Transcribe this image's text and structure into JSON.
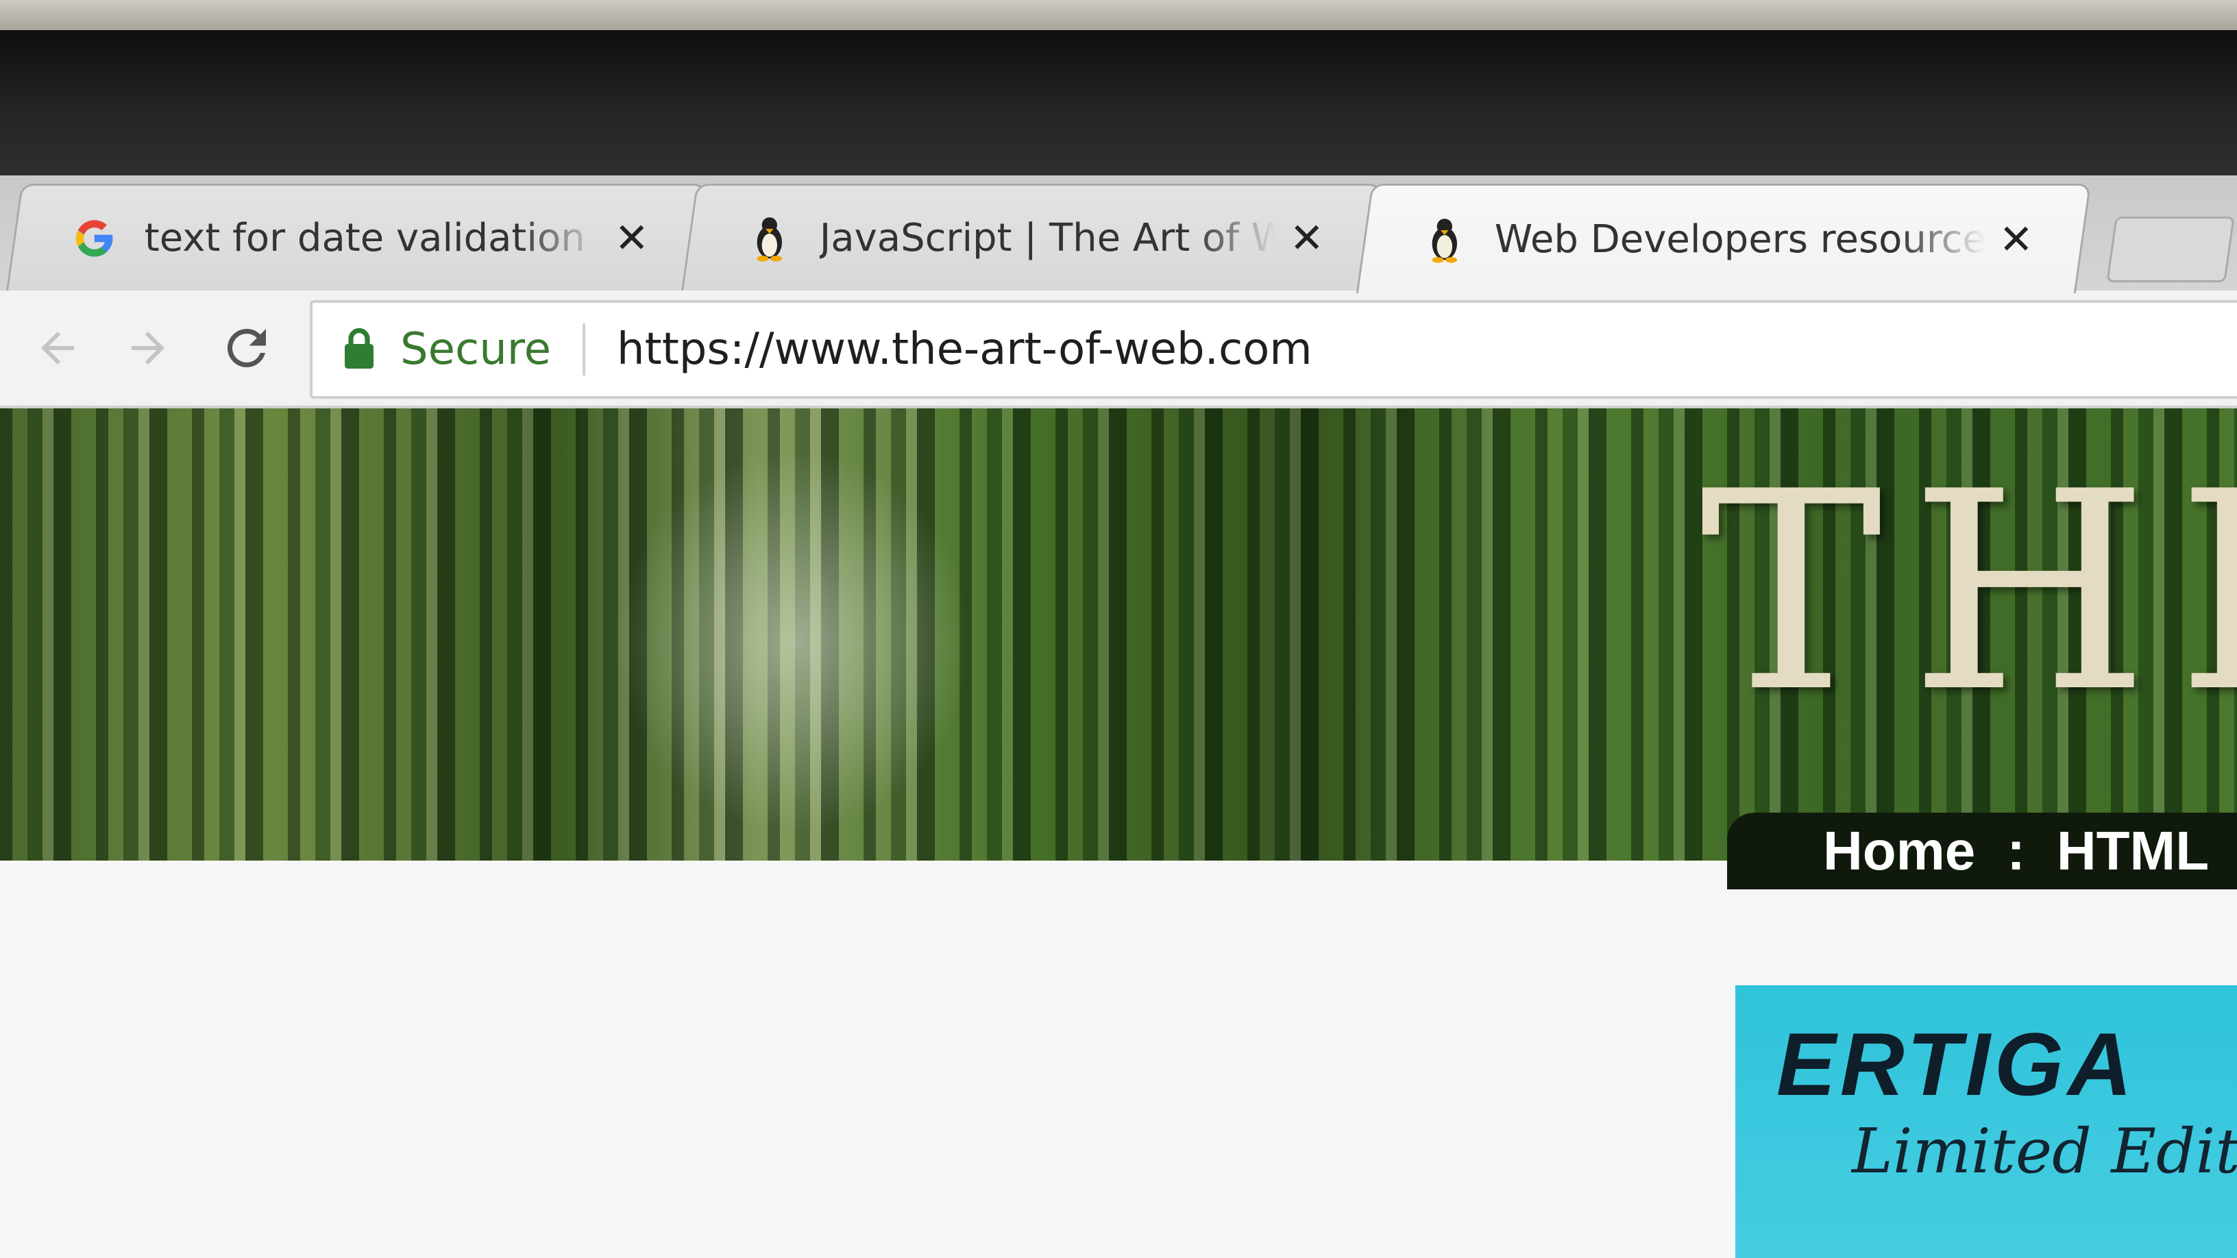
{
  "browser": {
    "tabs": [
      {
        "title": "text for date validation in",
        "icon": "google-icon",
        "close": "✕",
        "active": false
      },
      {
        "title": "JavaScript | The Art of Web",
        "icon": "penguin-icon",
        "close": "✕",
        "active": false
      },
      {
        "title": "Web Developers resources",
        "icon": "penguin-icon",
        "close": "✕",
        "active": true
      }
    ],
    "address_bar": {
      "secure_label": "Secure",
      "url": "https://www.the-art-of-web.com"
    },
    "icons": {
      "back": "back-arrow-icon",
      "forward": "forward-arrow-icon",
      "reload": "reload-icon",
      "lock": "lock-icon"
    }
  },
  "page": {
    "banner_title": "THE",
    "breadcrumb": [
      "Home",
      "HTML"
    ],
    "breadcrumb_separator": ":",
    "ad": {
      "brand": "ERTIGA",
      "subtitle": "Limited Edition"
    }
  }
}
